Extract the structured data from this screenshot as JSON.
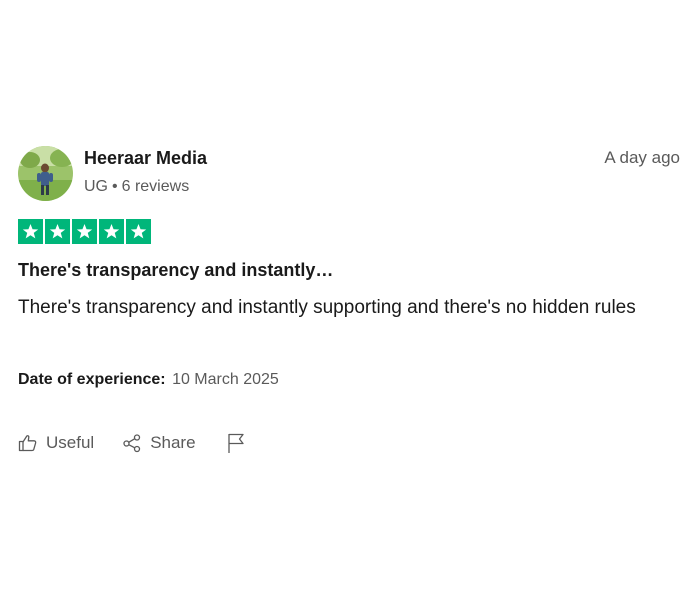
{
  "review": {
    "reviewer": {
      "name": "Heeraar Media",
      "country": "UG",
      "separator": "•",
      "reviews_count": "6 reviews",
      "avatar_icon": "user-photo-avatar"
    },
    "posted": "A day ago",
    "rating": {
      "stars": 5,
      "max": 5,
      "color": "#00b67a"
    },
    "title": "There's transparency and instantly…",
    "text": "There's transparency and instantly supporting and there's no hidden rules",
    "experience": {
      "label": "Date of experience:",
      "value": "10 March 2025"
    },
    "actions": {
      "useful_label": "Useful",
      "share_label": "Share",
      "useful_icon": "thumbs-up-icon",
      "share_icon": "share-icon",
      "flag_icon": "flag-icon"
    }
  }
}
